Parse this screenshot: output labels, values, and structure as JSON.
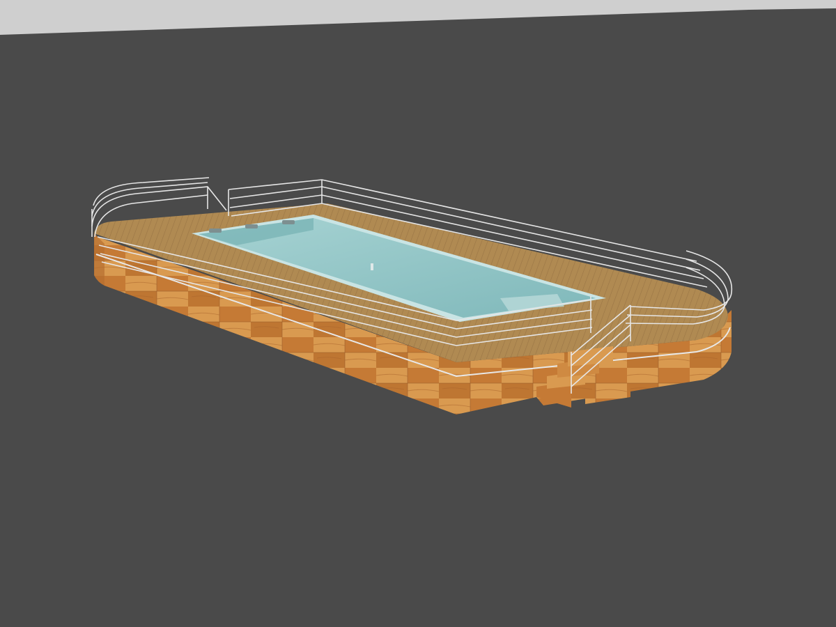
{
  "scene": {
    "subject": "above-ground-pool-with-wooden-deck",
    "colors": {
      "background": "#4a4a4a",
      "horizon": "#cfcfcf",
      "wood_light": "#d9954a",
      "wood_mid": "#c57a35",
      "wood_dark": "#a8612a",
      "deck": "#b08a52",
      "deck_dark": "#9a7545",
      "water": "#8fc3c3",
      "water_deep": "#6aa9ab",
      "pool_edge": "#c9e4e4",
      "rail": "#e6e6e6"
    }
  }
}
